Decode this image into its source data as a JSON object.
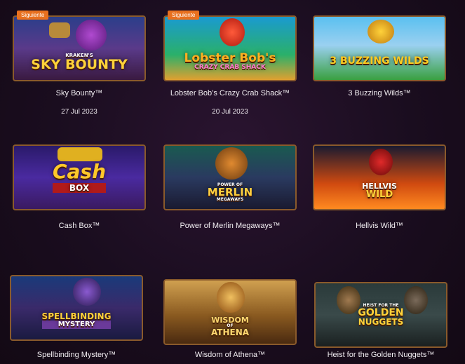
{
  "games": [
    {
      "name": "Sky Bounty™",
      "badge": "Siguiente",
      "date": "27 Jul 2023",
      "logo_top": "KRAKEN'S",
      "logo_main": "SKY BOUNTY"
    },
    {
      "name": "Lobster Bob’s Crazy Crab Shack™",
      "badge": "Siguiente",
      "date": "20 Jul 2023",
      "logo_top": "",
      "logo_main": "Lobster Bob's",
      "logo_sub": "CRAZY CRAB SHACK"
    },
    {
      "name": "3 Buzzing Wilds™",
      "logo_main": "3 BUZZING WILDS"
    },
    {
      "name": "Cash Box™",
      "logo_main": "Cash",
      "logo_sub": "BOX"
    },
    {
      "name": "Power of Merlin Megaways™",
      "logo_top": "POWER OF",
      "logo_main": "MERLIN",
      "logo_sub": "MEGAWAYS"
    },
    {
      "name": "Hellvis Wild™",
      "logo_main": "HELLVIS",
      "logo_sub": "WILD"
    },
    {
      "name": "Spellbinding Mystery™",
      "logo_main": "SPELLBINDING",
      "logo_sub": "MYSTERY"
    },
    {
      "name": "Wisdom of Athena™",
      "logo_main": "WISDOM",
      "logo_top": "OF",
      "logo_sub": "ATHENA"
    },
    {
      "name": "Heist for the Golden Nuggets™",
      "logo_top": "HEIST FOR THE",
      "logo_main": "GOLDEN",
      "logo_sub": "NUGGETS"
    }
  ],
  "colors": {
    "badge": "#e8701e",
    "frame": "#8a5a2b",
    "text": "#f2eef2"
  }
}
